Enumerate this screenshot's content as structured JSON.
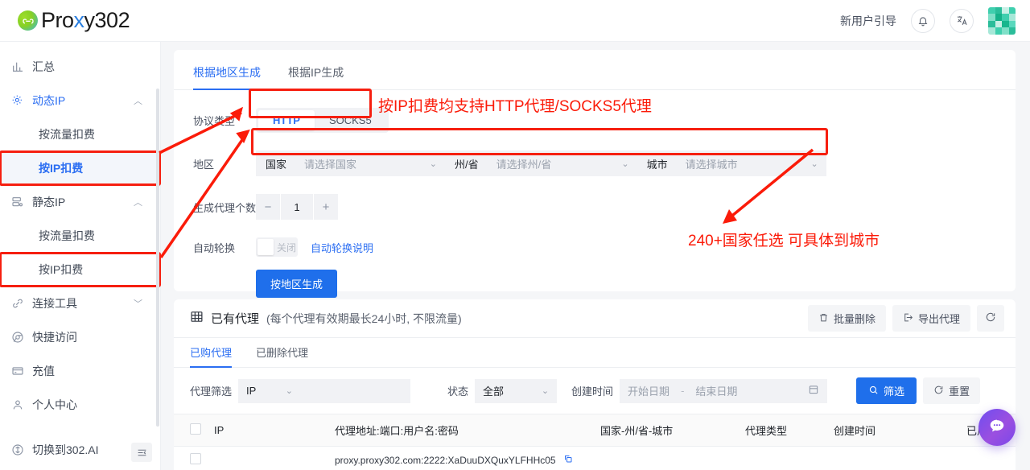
{
  "header": {
    "logo_prefix": "Pro",
    "logo_x": "x",
    "logo_suffix": "y302",
    "guide_link": "新用户引导",
    "bell_icon": "bell-icon",
    "translate_icon": "translate-icon",
    "avatar": "user-avatar"
  },
  "sidebar": {
    "items": [
      {
        "label": "汇总",
        "icon": "chart-bar-icon",
        "type": "item"
      },
      {
        "label": "动态IP",
        "icon": "gear-dynamic-icon",
        "type": "group",
        "expanded": true,
        "caret": "︿"
      },
      {
        "label": "按流量扣费",
        "type": "sub"
      },
      {
        "label": "按IP扣费",
        "type": "sub",
        "selected": true,
        "highlight": true
      },
      {
        "label": "静态IP",
        "icon": "server-icon",
        "type": "group",
        "expanded": true,
        "caret": "︿"
      },
      {
        "label": "按流量扣费",
        "type": "sub"
      },
      {
        "label": "按IP扣费",
        "type": "sub",
        "highlight": true
      },
      {
        "label": "连接工具",
        "icon": "link-icon",
        "type": "group",
        "expanded": false,
        "caret": "﹀"
      },
      {
        "label": "快捷访问",
        "icon": "chrome-icon",
        "type": "item"
      },
      {
        "label": "充值",
        "icon": "card-icon",
        "type": "item"
      },
      {
        "label": "个人中心",
        "icon": "user-icon",
        "type": "item"
      },
      {
        "label": "切换到302.AI",
        "icon": "switch-icon",
        "type": "item"
      }
    ],
    "collapse_icon": "collapse-sidebar-icon"
  },
  "generator": {
    "tabs": [
      {
        "label": "根据地区生成",
        "active": true
      },
      {
        "label": "根据IP生成",
        "active": false
      }
    ],
    "protocol": {
      "label": "协议类型",
      "options": [
        "HTTP",
        "SOCKS5"
      ],
      "selected": "HTTP"
    },
    "region": {
      "label": "地区",
      "country_label": "国家",
      "country_placeholder": "请选择国家",
      "state_label": "州/省",
      "state_placeholder": "请选择州/省",
      "city_label": "城市",
      "city_placeholder": "请选择城市"
    },
    "count": {
      "label": "生成代理个数",
      "minus": "−",
      "value": "1",
      "plus": "+"
    },
    "rotate": {
      "label": "自动轮换",
      "switch_text": "关闭",
      "help_link": "自动轮换说明"
    },
    "submit_label": "按地区生成"
  },
  "proxy_list": {
    "title": "已有代理",
    "title_note": "(每个代理有效期最长24小时, 不限流量)",
    "grid_icon": "table-grid-icon",
    "actions": [
      {
        "label": "批量删除",
        "icon": "trash-icon"
      },
      {
        "label": "导出代理",
        "icon": "export-icon"
      },
      {
        "label": "",
        "icon": "refresh-icon"
      }
    ],
    "tabs": [
      {
        "label": "已购代理",
        "active": true
      },
      {
        "label": "已删除代理",
        "active": false
      }
    ],
    "filters": {
      "proxy_filter_label": "代理筛选",
      "proxy_filter_value": "IP",
      "proxy_filter_input": "",
      "status_label": "状态",
      "status_value": "全部",
      "created_label": "创建时间",
      "date_start_placeholder": "开始日期",
      "date_dash": "-",
      "date_end_placeholder": "结束日期",
      "calendar_icon": "calendar-icon",
      "search_label": "筛选",
      "search_icon": "search-icon",
      "reset_label": "重置",
      "reset_icon": "reset-icon"
    },
    "columns": [
      "",
      "IP",
      "代理地址:端口:用户名:密码",
      "国家-州/省-城市",
      "代理类型",
      "创建时间",
      "已用IP"
    ],
    "rows": [
      {
        "ip": "",
        "address": "proxy.proxy302.com:2222:XaDuuDXQuxYLFHHc05",
        "copy_icon": "copy-icon",
        "region": "",
        "type": "",
        "created": "",
        "used": ""
      }
    ]
  },
  "annotations": [
    {
      "text": "按IP扣费均支持HTTP代理/SOCKS5代理",
      "color": "#fb1b09"
    },
    {
      "text": "240+国家任选 可具体到城市",
      "color": "#fb1b09"
    }
  ],
  "chat_fab": {
    "icon": "chat-bubble-icon"
  },
  "colors": {
    "accent": "#2b6ef2",
    "primary_button": "#1f6feb",
    "annotation_red": "#fb1b09",
    "highlight_box": "#f61f10"
  }
}
